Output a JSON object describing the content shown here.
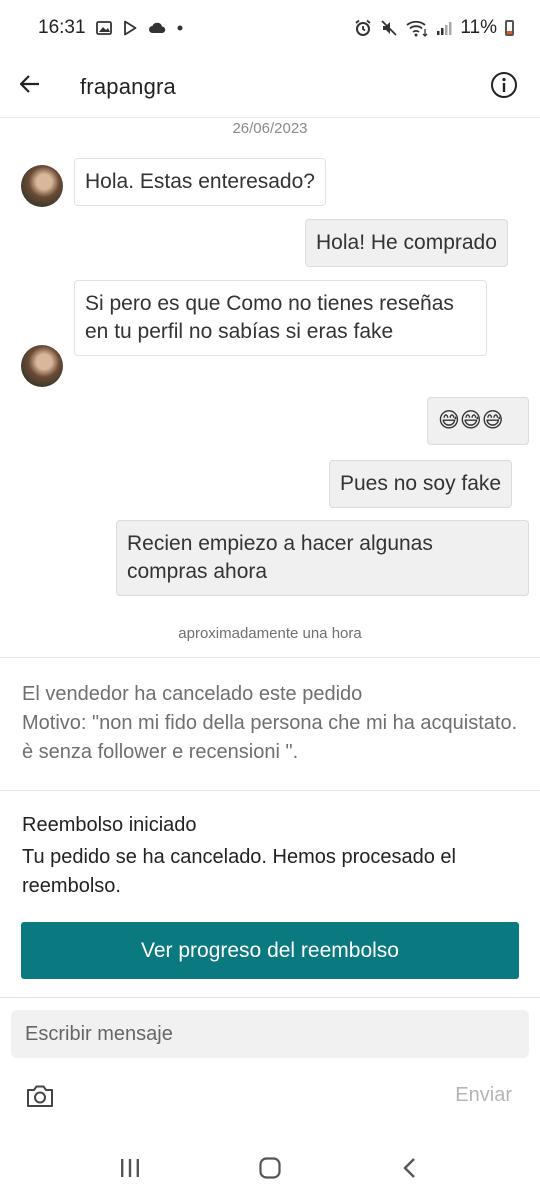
{
  "status_bar": {
    "time": "16:31",
    "battery": "11%"
  },
  "header": {
    "title": "frapangra"
  },
  "conversation": {
    "date": "26/06/2023",
    "messages": [
      {
        "side": "in",
        "text": "Hola. Estas enteresado?"
      },
      {
        "side": "out",
        "text": "Hola! He comprado"
      },
      {
        "side": "in",
        "text": "Si pero es que Como no tienes reseñas en tu perfil no sabías si eras fake"
      },
      {
        "side": "out",
        "text": "😅😅😅"
      },
      {
        "side": "out",
        "text": "Pues no soy fake"
      },
      {
        "side": "out",
        "text": "Recien empiezo a hacer algunas compras ahora"
      }
    ],
    "time_ago": "aproximadamente una hora"
  },
  "order_status": {
    "cancel_title": "El vendedor ha cancelado este pedido",
    "cancel_reason": "Motivo: \"non mi fido della persona che mi ha acquistato. è senza follower e recensioni \".",
    "refund_title": "Reembolso iniciado",
    "refund_text": "Tu pedido se ha cancelado. Hemos procesado el reembolso.",
    "refund_button": "Ver progreso del reembolso"
  },
  "composer": {
    "placeholder": "Escribir mensaje",
    "send_label": "Enviar"
  },
  "colors": {
    "accent": "#0b7980",
    "bubble_out": "#f0f0f0",
    "input_bg": "#f1f1f1"
  },
  "icons": {
    "back": "arrow-left-icon",
    "info": "info-icon",
    "camera": "camera-icon"
  }
}
